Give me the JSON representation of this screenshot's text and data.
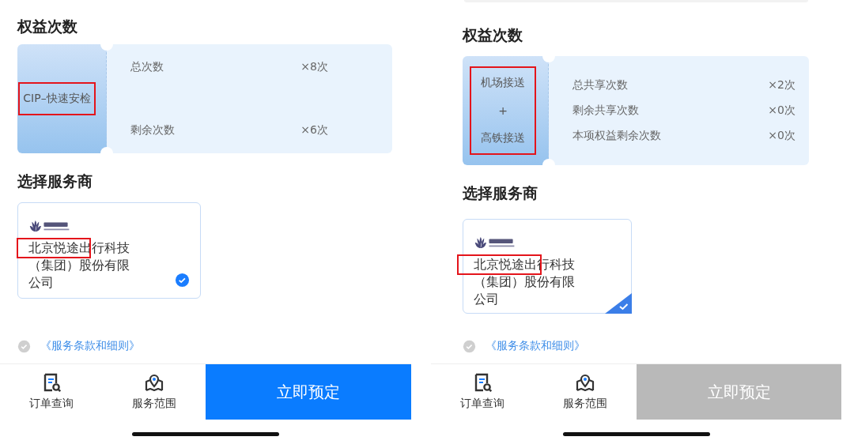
{
  "panels": [
    {
      "top_edge": false,
      "benefit_title": "权益次数",
      "benefit": {
        "name_lines": [
          "CIP–快速安检"
        ],
        "highlighted": true,
        "spread": true,
        "rows": [
          {
            "label": "总次数",
            "value": "×8次"
          },
          {
            "label": "剩余次数",
            "value": "×6次"
          }
        ]
      },
      "vendor_title": "选择服务商",
      "vendor": {
        "name": "北京悦途出行科技（集团）股份有限公司",
        "highlighted": true,
        "selected": true,
        "check_mark": {
          "kind": "circle"
        }
      },
      "terms": {
        "link": "《服务条款和细则》",
        "agreed": false
      },
      "nav": [
        {
          "kind": "orders",
          "label": "订单查询"
        },
        {
          "kind": "area",
          "label": "服务范围"
        }
      ],
      "book_button": {
        "label": "立即预定",
        "disabled": false
      }
    },
    {
      "top_edge": true,
      "benefit_title": "权益次数",
      "benefit": {
        "name_lines": [
          "机场接送",
          "+",
          "高铁接送"
        ],
        "highlighted": true,
        "spread": false,
        "rows": [
          {
            "label": "总共享次数",
            "value": "×2次"
          },
          {
            "label": "剩余共享次数",
            "value": "×0次"
          },
          {
            "label": "本项权益剩余次数",
            "value": "×0次"
          }
        ]
      },
      "vendor_title": "选择服务商",
      "vendor": {
        "name": "北京悦途出行科技（集团）股份有限公司",
        "highlighted": true,
        "selected": true,
        "check_mark": {
          "kind": "corner"
        }
      },
      "terms": {
        "link": "《服务条款和细则》",
        "agreed": false
      },
      "nav": [
        {
          "kind": "orders",
          "label": "订单查询"
        },
        {
          "kind": "area",
          "label": "服务范围"
        }
      ],
      "book_button": {
        "label": "立即预定",
        "disabled": true
      }
    }
  ]
}
